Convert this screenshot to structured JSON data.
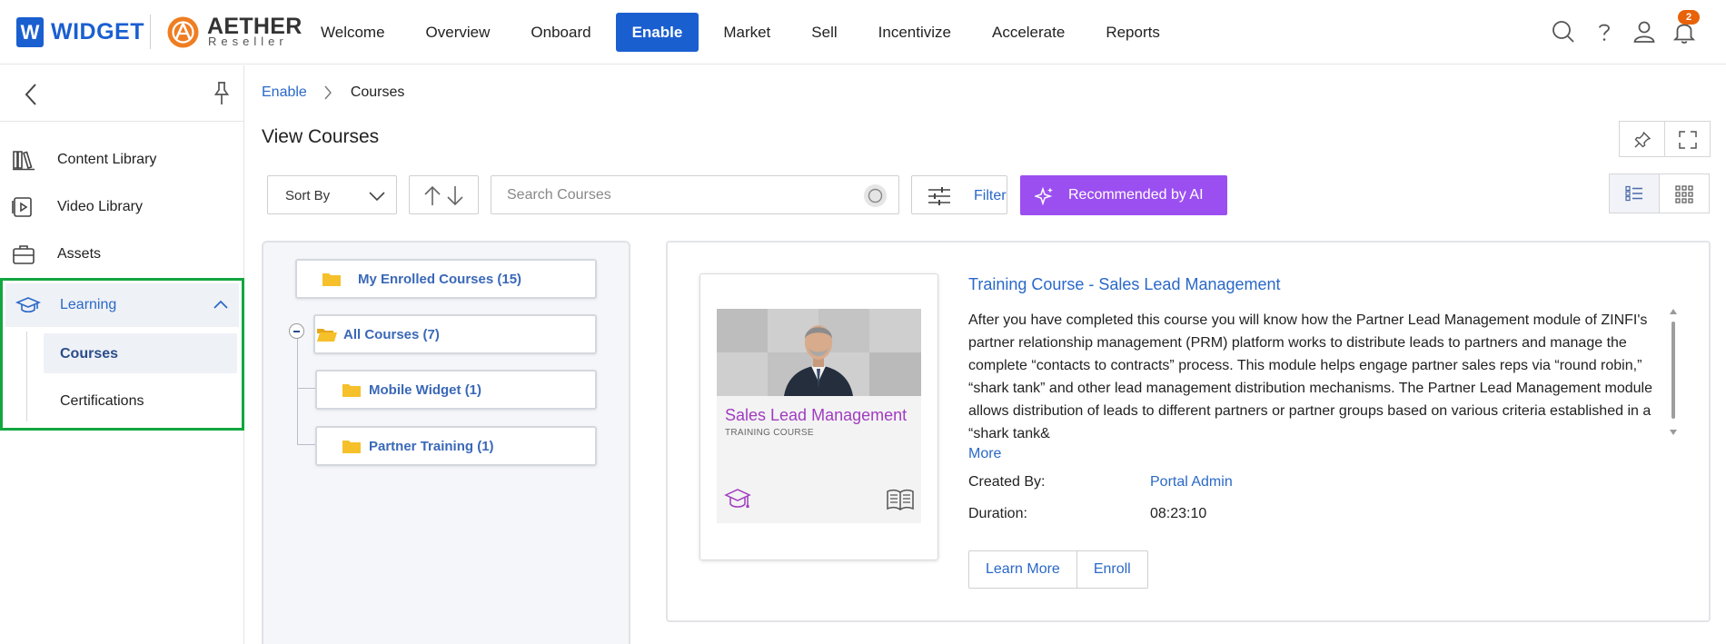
{
  "header": {
    "brand_letter": "W",
    "brand_name": "WIDGET",
    "partner_name": "AETHER",
    "partner_sub": "Reseller",
    "nav": [
      {
        "label": "Welcome"
      },
      {
        "label": "Overview"
      },
      {
        "label": "Onboard"
      },
      {
        "label": "Enable",
        "active": true
      },
      {
        "label": "Market"
      },
      {
        "label": "Sell"
      },
      {
        "label": "Incentivize"
      },
      {
        "label": "Accelerate"
      },
      {
        "label": "Reports"
      }
    ],
    "notification_count": "2",
    "icons": [
      "search-icon",
      "help-icon",
      "user-icon",
      "bell-icon"
    ]
  },
  "sidebar": {
    "items": [
      {
        "label": "Content Library",
        "icon": "books-icon"
      },
      {
        "label": "Video Library",
        "icon": "video-icon"
      },
      {
        "label": "Assets",
        "icon": "briefcase-icon"
      }
    ],
    "learning": {
      "label": "Learning",
      "icon": "graduation-cap-icon",
      "expanded": true,
      "children": [
        {
          "label": "Courses",
          "active": true
        },
        {
          "label": "Certifications"
        }
      ]
    }
  },
  "breadcrumb": {
    "parent": "Enable",
    "current": "Courses"
  },
  "page": {
    "title": "View Courses"
  },
  "toolbar": {
    "sort_label": "Sort By",
    "search_placeholder": "Search Courses",
    "filter_label": "Filter",
    "ai_label": "Recommended by AI",
    "view_mode": "list"
  },
  "tree": {
    "enrolled": "My Enrolled Courses (15)",
    "all": "All Courses (7)",
    "children": [
      "Mobile Widget (1)",
      "Partner Training (1)"
    ]
  },
  "course": {
    "thumb_title": "Sales Lead Management",
    "thumb_sub": "TRAINING COURSE",
    "title": "Training Course - Sales Lead Management",
    "description": "After you have completed this course you will know how the Partner Lead Management module of ZINFI's partner relationship management (PRM) platform works to distribute leads to partners and manage the complete “contacts to contracts” process. This module helps engage partner sales reps via “round robin,” “shark tank” and other lead management distribution mechanisms. The Partner Lead Management module allows distribution of leads to different partners or partner groups based on various criteria established in a “shark tank&",
    "more_label": "More",
    "created_by_label": "Created By:",
    "created_by": "Portal Admin",
    "duration_label": "Duration:",
    "duration": "08:23:10",
    "learn_more_label": "Learn More",
    "enroll_label": "Enroll"
  },
  "colors": {
    "brand_blue": "#1a5fd0",
    "link_blue": "#2a68c8",
    "ai_purple": "#9b4ff0",
    "highlight_green": "#12a640",
    "badge_orange": "#e8620a",
    "folder_yellow": "#f5c02a"
  }
}
